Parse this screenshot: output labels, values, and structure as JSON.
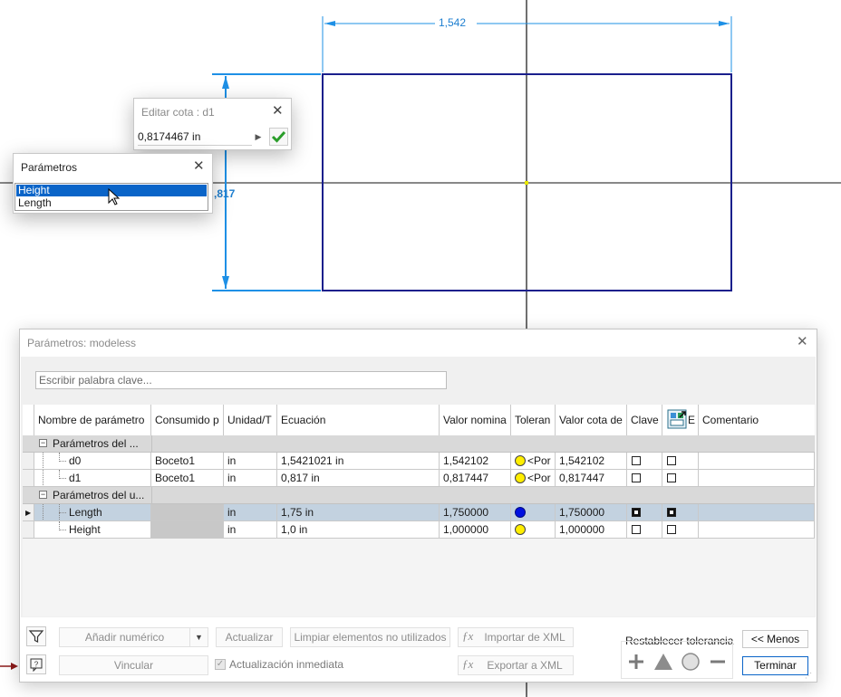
{
  "sketch": {
    "dim_horizontal": "1,542",
    "dim_vertical": ",817"
  },
  "edit_dimension": {
    "title": "Editar cota : d1",
    "value": "0,8174467 in"
  },
  "param_picker": {
    "title": "Parámetros",
    "items": [
      "Height",
      "Length"
    ]
  },
  "dialog": {
    "title": "Parámetros: modeless",
    "search_placeholder": "Escribir palabra clave...",
    "columns": [
      "Nombre de parámetro",
      "Consumido p",
      "Unidad/T",
      "Ecuación",
      "Valor nomina",
      "Toleran",
      "Valor cota de",
      "Clave",
      "E",
      "Comentario"
    ],
    "groups": [
      {
        "label": "Parámetros del ...",
        "rows": [
          {
            "name": "d0",
            "consumed": "Boceto1",
            "unit": "in",
            "equation": "1,5421021 in",
            "nominal": "1,542102",
            "tolerance": "<Por",
            "model_value": "1,542102",
            "key": false,
            "export": false
          },
          {
            "name": "d1",
            "consumed": "Boceto1",
            "unit": "in",
            "equation": "0,817 in",
            "nominal": "0,817447",
            "tolerance": "<Por",
            "model_value": "0,817447",
            "key": false,
            "export": false
          }
        ]
      },
      {
        "label": "Parámetros del u...",
        "rows": [
          {
            "name": "Length",
            "consumed": "",
            "unit": "in",
            "equation": "1,75 in",
            "nominal": "1,750000",
            "tolerance": "",
            "model_value": "1,750000",
            "key": true,
            "export": true
          },
          {
            "name": "Height",
            "consumed": "",
            "unit": "in",
            "equation": "1,0 in",
            "nominal": "1,000000",
            "tolerance": "",
            "model_value": "1,000000",
            "key": false,
            "export": false
          }
        ]
      }
    ],
    "buttons": {
      "add_numeric": "Añadir numérico",
      "update": "Actualizar",
      "purge": "Limpiar elementos no utilizados",
      "import_xml": "Importar de XML",
      "link": "Vincular",
      "immediate_update": "Actualización inmediata",
      "export_xml": "Exportar a XML",
      "reset_tolerance": "Restablecer tolerancia",
      "less": "<< Menos",
      "done": "Terminar"
    }
  },
  "colors": {
    "sketch_line": "#1a1f8c",
    "dimension": "#1e90e6",
    "selection": "#0a64c8",
    "selected_row": "#c3d2e0",
    "tolerance_yellow": "#ffee00",
    "tolerance_blue": "#0010e0",
    "accept_check": "#2a9d2a"
  }
}
